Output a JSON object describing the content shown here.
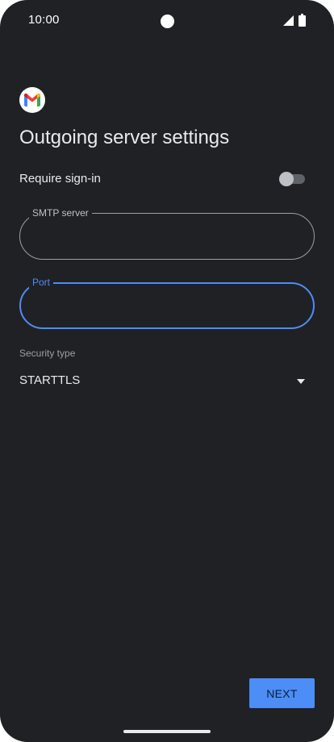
{
  "status_bar": {
    "time": "10:00",
    "icons": [
      "camera-cutout",
      "signal-icon",
      "battery-icon"
    ]
  },
  "app": {
    "logo_icon": "gmail-logo-icon"
  },
  "page": {
    "title": "Outgoing server settings"
  },
  "require_signin": {
    "label": "Require sign-in",
    "enabled": false
  },
  "fields": {
    "smtp_server": {
      "label": "SMTP server",
      "value": ""
    },
    "port": {
      "label": "Port",
      "value": ""
    }
  },
  "security": {
    "label": "Security type",
    "value": "STARTTLS",
    "icon": "dropdown-arrow-icon"
  },
  "actions": {
    "next_label": "NEXT"
  },
  "colors": {
    "background": "#202124",
    "accent": "#4c8df6",
    "text": "#e8eaed",
    "muted": "#9aa0a6"
  }
}
